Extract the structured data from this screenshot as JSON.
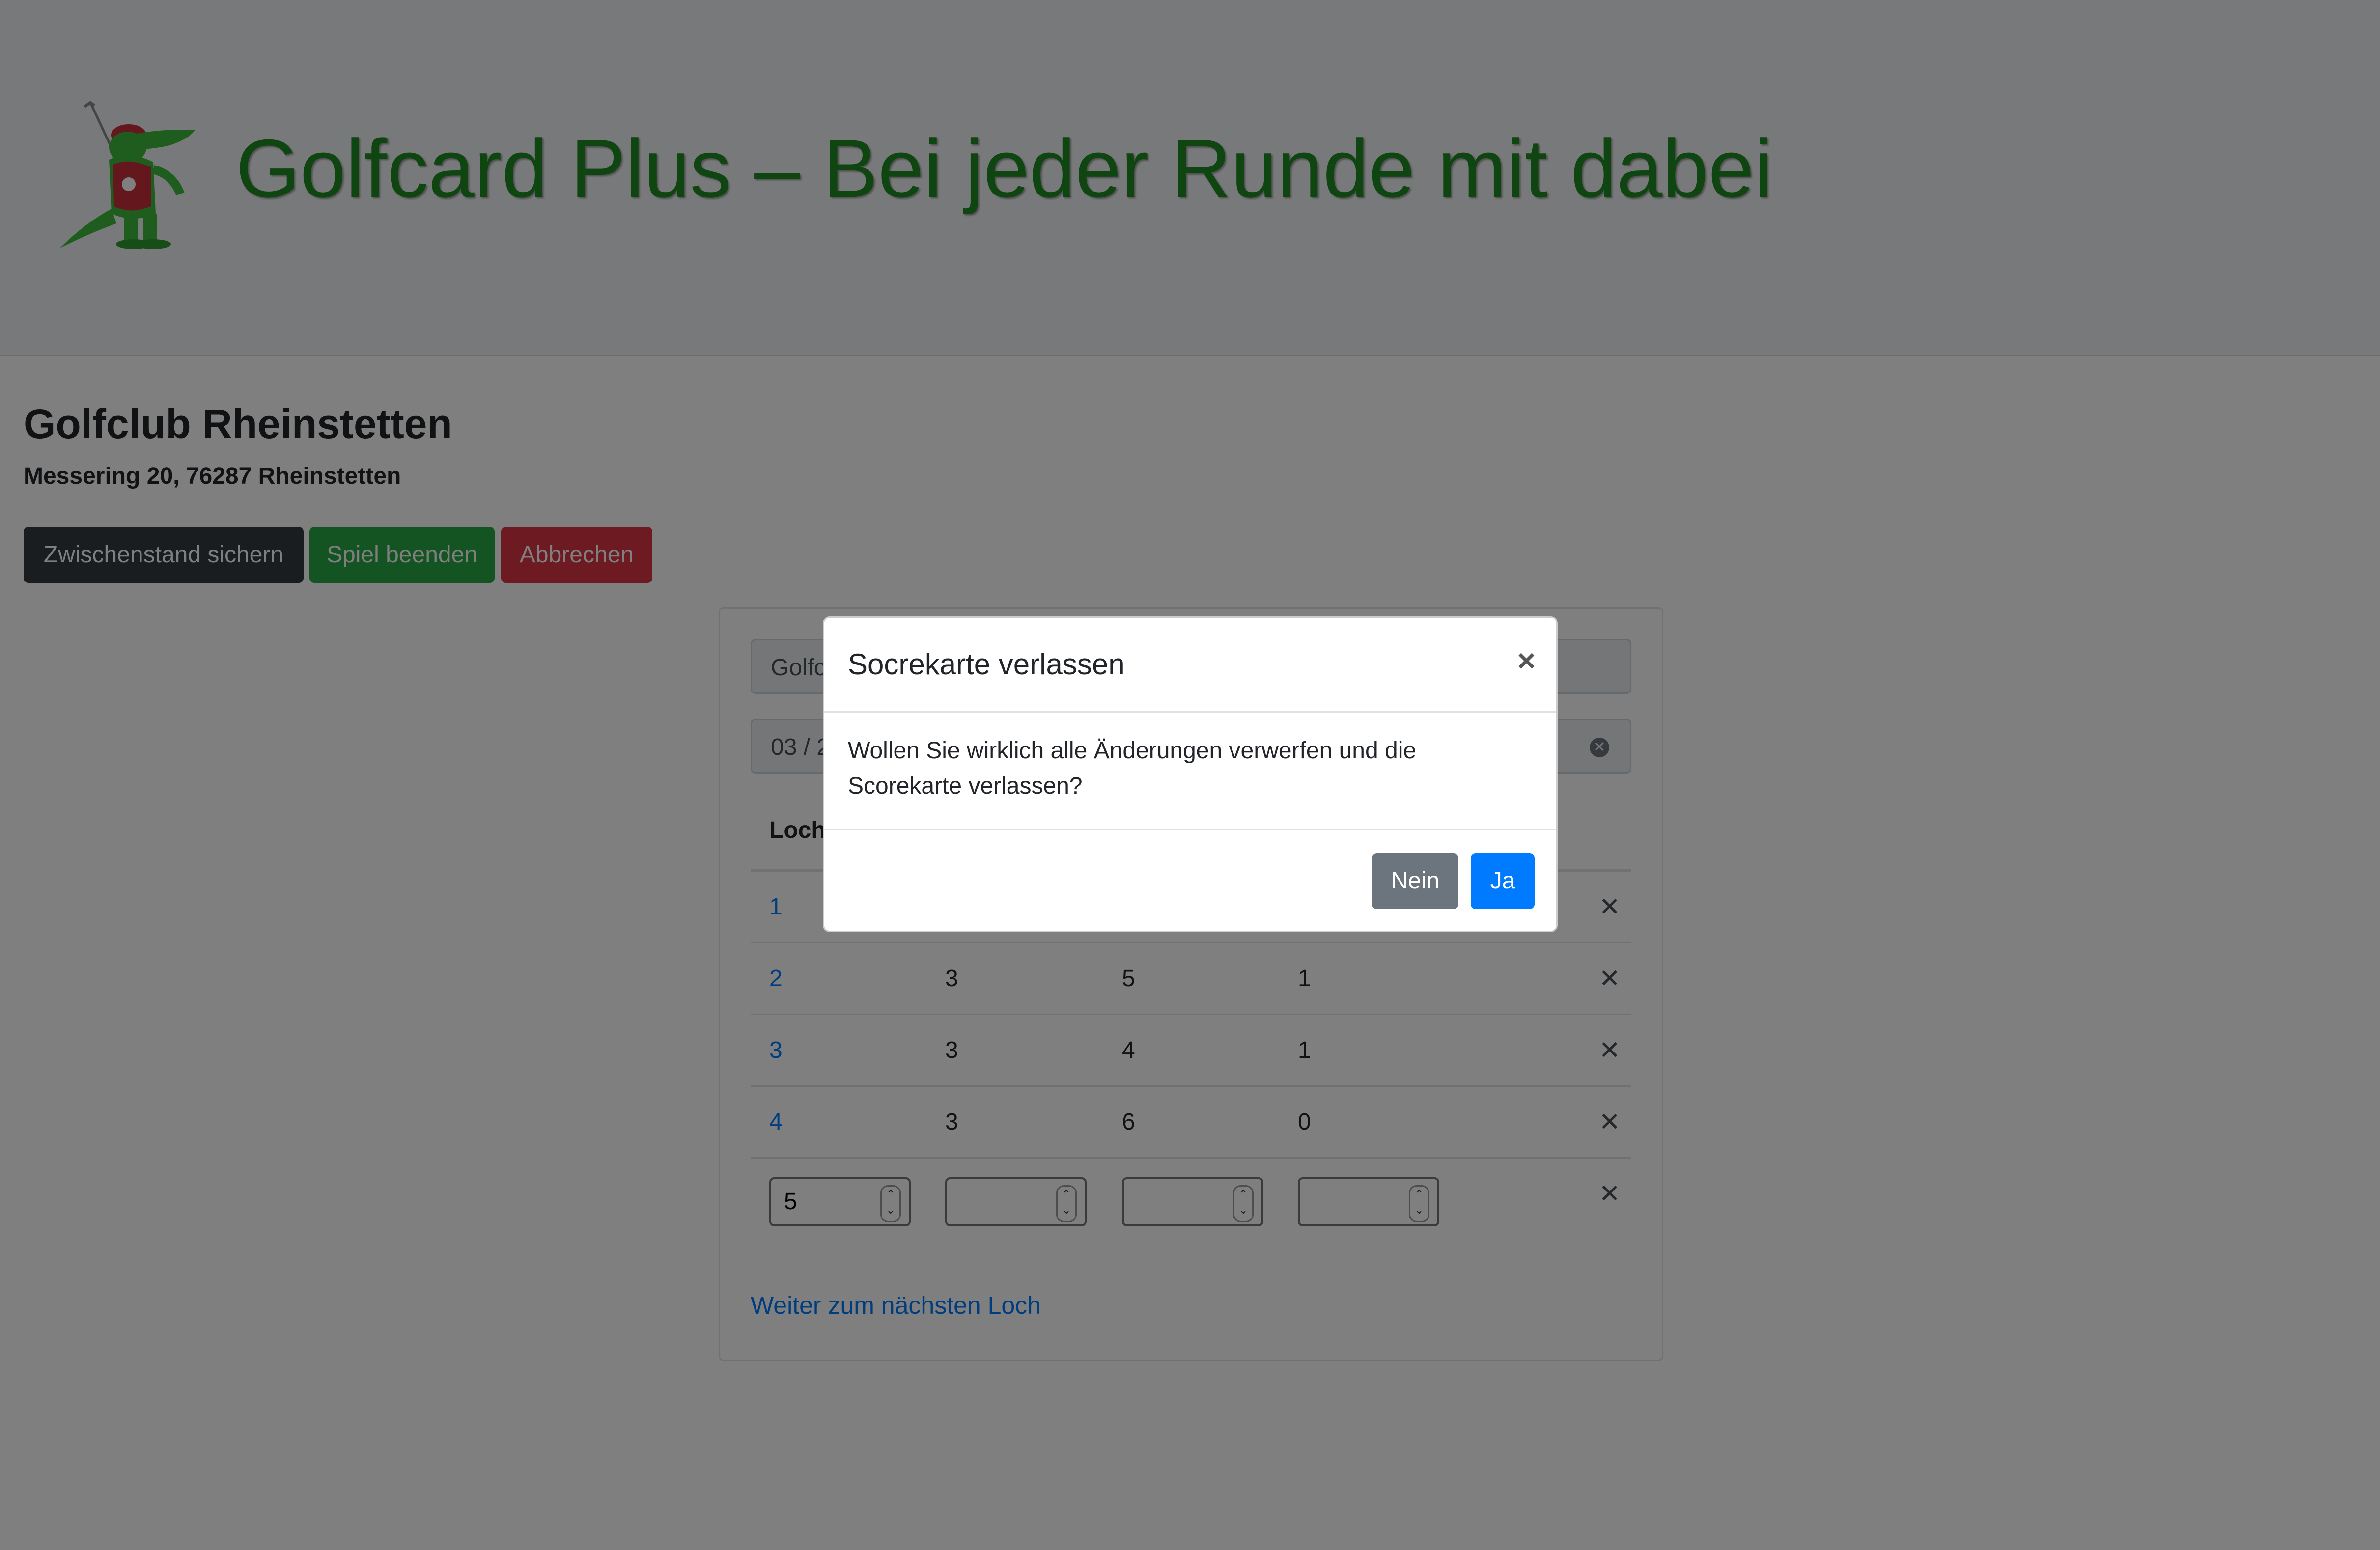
{
  "header": {
    "title": "Golfcard Plus – Bei jeder Runde mit dabei"
  },
  "club": {
    "name": "Golfclub Rheinstetten",
    "address": "Messering 20, 76287 Rheinstetten"
  },
  "actions": {
    "save_label": "Zwischenstand sichern",
    "finish_label": "Spiel beenden",
    "abort_label": "Abbrechen"
  },
  "scorecard": {
    "club_field_value": "Golfc",
    "date_field_value": "03 / 2",
    "headers": [
      "Loch"
    ],
    "rows": [
      {
        "hole": "1",
        "col2": "",
        "col3": "",
        "col4": ""
      },
      {
        "hole": "2",
        "col2": "3",
        "col3": "5",
        "col4": "1"
      },
      {
        "hole": "3",
        "col2": "3",
        "col3": "4",
        "col4": "1"
      },
      {
        "hole": "4",
        "col2": "3",
        "col3": "6",
        "col4": "0"
      }
    ],
    "input_row": {
      "hole": "5",
      "col2": "",
      "col3": "",
      "col4": ""
    },
    "next_hole_link": "Weiter zum nächsten Loch",
    "remove_icon": "close-icon"
  },
  "modal": {
    "title": "Socrekarte verlassen",
    "body": "Wollen Sie wirklich alle Änderungen verwerfen und die Scorekarte verlassen?",
    "no_label": "Nein",
    "yes_label": "Ja"
  },
  "colors": {
    "brand_green": "#1f8a22",
    "primary": "#007bff",
    "secondary": "#6c757d",
    "dark": "#343a40",
    "success": "#28a745",
    "danger": "#dc3545"
  }
}
